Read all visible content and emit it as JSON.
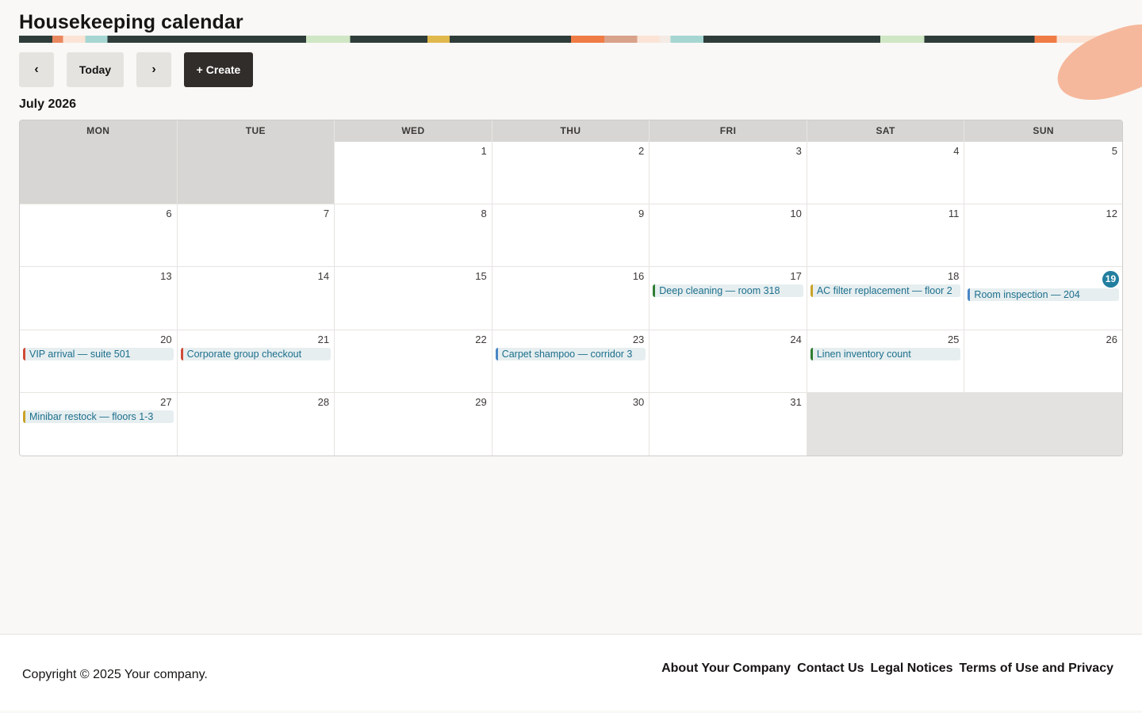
{
  "page": {
    "title": "Housekeeping calendar"
  },
  "toolbar": {
    "prev_label": "‹",
    "today_label": "Today",
    "next_label": "›",
    "create_label": "+ Create"
  },
  "calendar": {
    "month_title": "July 2026",
    "weekdays": [
      "MON",
      "TUE",
      "WED",
      "THU",
      "FRI",
      "SAT",
      "SUN"
    ],
    "today": 19,
    "days": [
      "1",
      "2",
      "3",
      "4",
      "5",
      "6",
      "7",
      "8",
      "9",
      "10",
      "11",
      "12",
      "13",
      "14",
      "15",
      "16",
      "17",
      "18",
      "19",
      "20",
      "21",
      "22",
      "23",
      "24",
      "25",
      "26",
      "27",
      "28",
      "29",
      "30",
      "31"
    ],
    "events": {
      "deep_cleaning": {
        "day": "17",
        "label": "Deep cleaning — room 318",
        "color": "#2e7d32"
      },
      "ac_filter": {
        "day": "18",
        "label": "AC filter replacement — floor 2",
        "color": "#c9a227"
      },
      "room_inspection": {
        "day": "19",
        "label": "Room inspection — 204",
        "color": "#4a86c5"
      },
      "vip_arrival": {
        "day": "20",
        "label": "VIP arrival — suite 501",
        "color": "#d04a35"
      },
      "corporate_checkout": {
        "day": "21",
        "label": "Corporate group checkout",
        "color": "#d04a35"
      },
      "carpet_shampoo": {
        "day": "23",
        "label": "Carpet shampoo — corridor 3",
        "color": "#4a86c5"
      },
      "linen_inventory": {
        "day": "25",
        "label": "Linen inventory count",
        "color": "#2e7d32"
      },
      "minibar_restock": {
        "day": "27",
        "label": "Minibar restock — floors 1-3",
        "color": "#c9a227"
      }
    }
  },
  "footer": {
    "copyright": "Copyright © 2025 Your company.",
    "links": [
      "About Your Company",
      "Contact Us",
      "Legal Notices",
      "Terms of Use and Privacy"
    ]
  },
  "colors": {
    "accent": "#227e9e",
    "create_button": "#312d2a"
  }
}
